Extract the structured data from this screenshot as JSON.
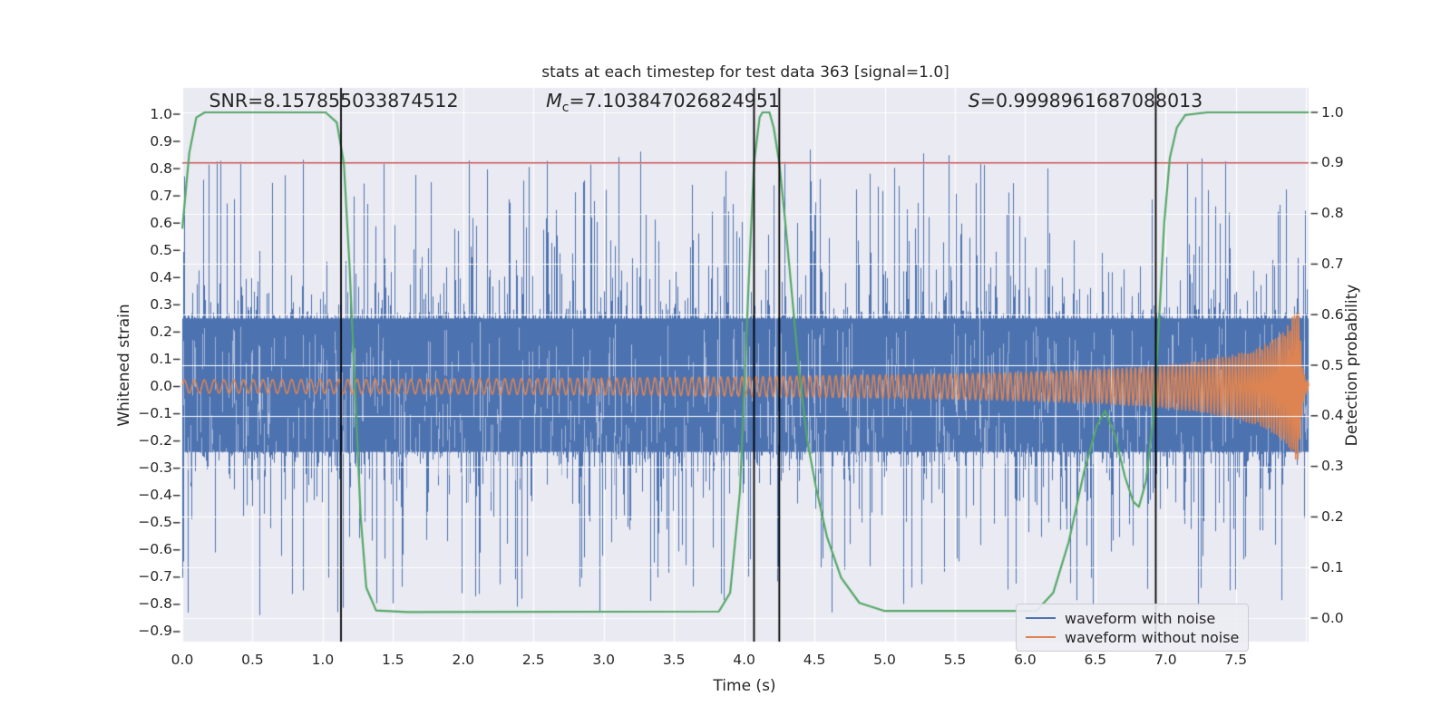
{
  "palette": {
    "page_bg": "#ffffff",
    "plot_bg": "#eaeaf2",
    "grid": "#ffffff",
    "text": "#262626",
    "noise_blue": "#4c72b0",
    "chirp_orange": "#dd8452",
    "prob_green": "#55a868",
    "threshold_red": "#c44e52",
    "vline_black": "#000000"
  },
  "header": {
    "title": "stats at each timestep for test data 363 [signal=1.0]"
  },
  "annotations": {
    "snr": {
      "text": "SNR=8.157855033874512"
    },
    "chirp_mass": {
      "var": "M",
      "sub": "c",
      "value": "=7.103847026824951"
    },
    "signal": {
      "var": "S",
      "value": "=0.9998961687088013"
    }
  },
  "legend": {
    "items": [
      {
        "label": "waveform with noise",
        "color": "#4c72b0"
      },
      {
        "label": "waveform without noise",
        "color": "#dd8452"
      }
    ]
  },
  "chart_data": {
    "type": "line",
    "title": "stats at each timestep for test data 363 [signal=1.0]",
    "xlabel": "Time (s)",
    "ylabel_left": "Whitened strain",
    "ylabel_right": "Detection probability",
    "xlim": [
      0,
      8.02
    ],
    "ylim_left": [
      -0.93,
      1.1
    ],
    "ylim_right": [
      -0.05,
      1.05
    ],
    "grid": {
      "vertical_step_s": 0.5,
      "horizontal_axis": "right",
      "horizontal_step": 0.1
    },
    "x_ticks": [
      {
        "v": 0.0,
        "label": "0.0"
      },
      {
        "v": 0.5,
        "label": "0.5"
      },
      {
        "v": 1.0,
        "label": "1.0"
      },
      {
        "v": 1.5,
        "label": "1.5"
      },
      {
        "v": 2.0,
        "label": "2.0"
      },
      {
        "v": 2.5,
        "label": "2.5"
      },
      {
        "v": 3.0,
        "label": "3.0"
      },
      {
        "v": 3.5,
        "label": "3.5"
      },
      {
        "v": 4.0,
        "label": "4.0"
      },
      {
        "v": 4.5,
        "label": "4.5"
      },
      {
        "v": 5.0,
        "label": "5.0"
      },
      {
        "v": 5.5,
        "label": "5.5"
      },
      {
        "v": 6.0,
        "label": "6.0"
      },
      {
        "v": 6.5,
        "label": "6.5"
      },
      {
        "v": 7.0,
        "label": "7.0"
      },
      {
        "v": 7.5,
        "label": "7.5"
      }
    ],
    "y_left_ticks": [
      {
        "v": 1.0,
        "label": "1.0"
      },
      {
        "v": 0.9,
        "label": "0.9"
      },
      {
        "v": 0.8,
        "label": "0.8"
      },
      {
        "v": 0.7,
        "label": "0.7"
      },
      {
        "v": 0.6,
        "label": "0.6"
      },
      {
        "v": 0.5,
        "label": "0.5"
      },
      {
        "v": 0.4,
        "label": "0.4"
      },
      {
        "v": 0.3,
        "label": "0.3"
      },
      {
        "v": 0.2,
        "label": "0.2"
      },
      {
        "v": 0.1,
        "label": "0.1"
      },
      {
        "v": 0.0,
        "label": "0.0"
      },
      {
        "v": -0.1,
        "label": "−0.1"
      },
      {
        "v": -0.2,
        "label": "−0.2"
      },
      {
        "v": -0.3,
        "label": "−0.3"
      },
      {
        "v": -0.4,
        "label": "−0.4"
      },
      {
        "v": -0.5,
        "label": "−0.5"
      },
      {
        "v": -0.6,
        "label": "−0.6"
      },
      {
        "v": -0.7,
        "label": "−0.7"
      },
      {
        "v": -0.8,
        "label": "−0.8"
      },
      {
        "v": -0.9,
        "label": "−0.9"
      }
    ],
    "y_right_ticks": [
      {
        "v": 1.0,
        "label": "1.0"
      },
      {
        "v": 0.9,
        "label": "0.9"
      },
      {
        "v": 0.8,
        "label": "0.8"
      },
      {
        "v": 0.7,
        "label": "0.7"
      },
      {
        "v": 0.6,
        "label": "0.6"
      },
      {
        "v": 0.5,
        "label": "0.5"
      },
      {
        "v": 0.4,
        "label": "0.4"
      },
      {
        "v": 0.3,
        "label": "0.3"
      },
      {
        "v": 0.2,
        "label": "0.2"
      },
      {
        "v": 0.1,
        "label": "0.1"
      },
      {
        "v": 0.0,
        "label": "0.0"
      }
    ],
    "threshold_line": {
      "axis": "right",
      "value": 0.9,
      "color": "#c44e52"
    },
    "event_vlines": {
      "color": "#000000",
      "times_s": [
        1.13,
        4.07,
        4.25,
        6.93
      ]
    },
    "series": [
      {
        "name": "waveform with noise",
        "type": "noise_band",
        "axis": "left",
        "color": "#4c72b0",
        "seed": 363,
        "core_amplitude": 0.25,
        "spike_max_pos": 0.9,
        "spike_max_neg": -0.84
      },
      {
        "name": "waveform without noise",
        "type": "chirp",
        "axis": "left",
        "color": "#dd8452",
        "sample_dt_s": 0.003,
        "amplitude_envelope": [
          [
            0,
            0.024
          ],
          [
            1,
            0.026
          ],
          [
            2,
            0.028
          ],
          [
            3,
            0.031
          ],
          [
            4,
            0.036
          ],
          [
            5,
            0.043
          ],
          [
            5.5,
            0.047
          ],
          [
            6,
            0.053
          ],
          [
            6.5,
            0.062
          ],
          [
            6.9,
            0.075
          ],
          [
            7.2,
            0.09
          ],
          [
            7.45,
            0.112
          ],
          [
            7.65,
            0.14
          ],
          [
            7.8,
            0.18
          ],
          [
            7.88,
            0.23
          ],
          [
            7.93,
            0.285
          ],
          [
            7.95,
            0.275
          ],
          [
            7.965,
            0.14
          ],
          [
            7.98,
            0.06
          ],
          [
            8.0,
            0.025
          ],
          [
            8.02,
            0.01
          ]
        ],
        "frequency_hz": [
          [
            0,
            14
          ],
          [
            1,
            15
          ],
          [
            2,
            16.5
          ],
          [
            3,
            18
          ],
          [
            4,
            20
          ],
          [
            5,
            23
          ],
          [
            5.5,
            25
          ],
          [
            6,
            27
          ],
          [
            6.5,
            30
          ],
          [
            7,
            35
          ],
          [
            7.3,
            40
          ],
          [
            7.55,
            46
          ],
          [
            7.75,
            53
          ],
          [
            7.9,
            62
          ],
          [
            7.96,
            70
          ],
          [
            8.02,
            78
          ]
        ]
      },
      {
        "name": "detection probability",
        "type": "curve",
        "axis": "right",
        "color": "#55a868",
        "points": [
          [
            0,
            0.77
          ],
          [
            0.05,
            0.92
          ],
          [
            0.1,
            0.99
          ],
          [
            0.16,
            1.0
          ],
          [
            1.02,
            1.0
          ],
          [
            1.1,
            0.98
          ],
          [
            1.15,
            0.9
          ],
          [
            1.19,
            0.7
          ],
          [
            1.23,
            0.45
          ],
          [
            1.27,
            0.2
          ],
          [
            1.31,
            0.06
          ],
          [
            1.38,
            0.015
          ],
          [
            1.6,
            0.012
          ],
          [
            3.82,
            0.013
          ],
          [
            3.9,
            0.05
          ],
          [
            3.97,
            0.25
          ],
          [
            4.03,
            0.65
          ],
          [
            4.07,
            0.9
          ],
          [
            4.11,
            0.99
          ],
          [
            4.13,
            1.0
          ],
          [
            4.18,
            1.0
          ],
          [
            4.21,
            0.97
          ],
          [
            4.25,
            0.9
          ],
          [
            4.29,
            0.79
          ],
          [
            4.34,
            0.64
          ],
          [
            4.39,
            0.49
          ],
          [
            4.45,
            0.35
          ],
          [
            4.51,
            0.26
          ],
          [
            4.59,
            0.16
          ],
          [
            4.69,
            0.08
          ],
          [
            4.82,
            0.03
          ],
          [
            5.0,
            0.014
          ],
          [
            6.08,
            0.014
          ],
          [
            6.2,
            0.05
          ],
          [
            6.31,
            0.15
          ],
          [
            6.42,
            0.29
          ],
          [
            6.51,
            0.38
          ],
          [
            6.57,
            0.41
          ],
          [
            6.64,
            0.36
          ],
          [
            6.71,
            0.28
          ],
          [
            6.77,
            0.23
          ],
          [
            6.81,
            0.22
          ],
          [
            6.86,
            0.27
          ],
          [
            6.91,
            0.39
          ],
          [
            6.95,
            0.57
          ],
          [
            6.99,
            0.78
          ],
          [
            7.03,
            0.91
          ],
          [
            7.08,
            0.97
          ],
          [
            7.14,
            0.995
          ],
          [
            7.3,
            1.0
          ],
          [
            8.02,
            1.0
          ]
        ]
      }
    ]
  }
}
